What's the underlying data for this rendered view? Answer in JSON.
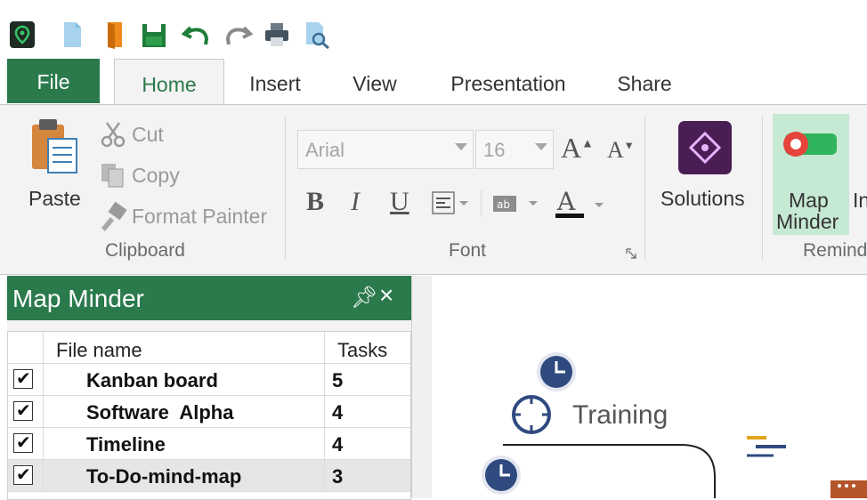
{
  "quick_access": {
    "icons": [
      "app-logo-icon",
      "new-document-icon",
      "open-folder-icon",
      "save-icon",
      "undo-icon",
      "redo-icon",
      "print-icon",
      "print-preview-icon"
    ]
  },
  "tabs": {
    "file": "File",
    "home": "Home",
    "insert": "Insert",
    "view": "View",
    "presentation": "Presentation",
    "share": "Share"
  },
  "ribbon": {
    "clipboard": {
      "paste": "Paste",
      "cut": "Cut",
      "copy": "Copy",
      "format_painter": "Format Painter",
      "group_label": "Clipboard"
    },
    "font": {
      "family": "Arial",
      "size": "16",
      "group_label": "Font"
    },
    "solutions": {
      "label": "Solutions"
    },
    "reminder": {
      "map_minder_line1": "Map",
      "map_minder_line2": "Minder",
      "next_partial": "In",
      "group_label_partial": "Remind"
    }
  },
  "panel": {
    "title": "Map Minder",
    "columns": {
      "file_name": "File name",
      "tasks": "Tasks"
    },
    "rows": [
      {
        "name": "Kanban board",
        "tasks": "5",
        "checked": true
      },
      {
        "name": "Software  Alpha",
        "tasks": "4",
        "checked": true
      },
      {
        "name": "Timeline",
        "tasks": "4",
        "checked": true
      },
      {
        "name": "To-Do-mind-map",
        "tasks": "3",
        "checked": true
      }
    ]
  },
  "canvas": {
    "node_label": "Training"
  },
  "colors": {
    "accent_green": "#2a7a4c",
    "navy": "#2f4a7f",
    "solutions_purple": "#4a1e55"
  }
}
